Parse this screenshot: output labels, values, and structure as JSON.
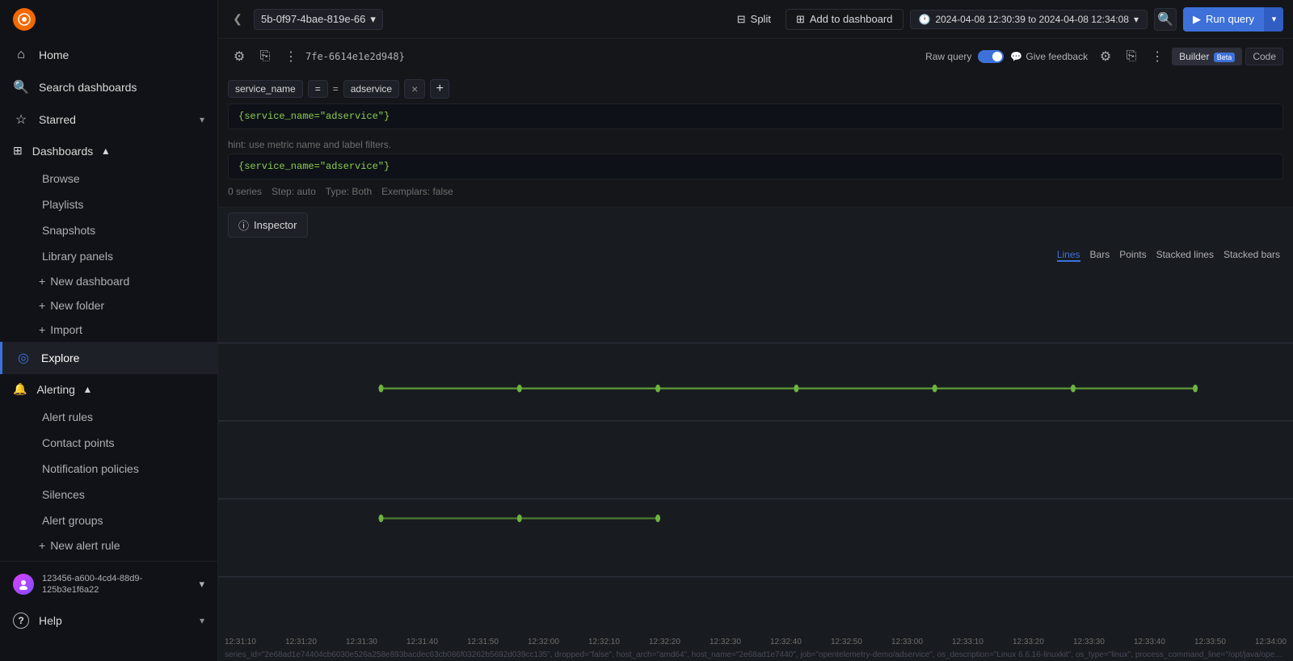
{
  "sidebar": {
    "logo": "G",
    "items": [
      {
        "id": "home",
        "label": "Home",
        "icon": "home-icon",
        "active": false
      },
      {
        "id": "search",
        "label": "Search dashboards",
        "icon": "search-icon",
        "active": false
      },
      {
        "id": "starred",
        "label": "Starred",
        "icon": "star-icon",
        "active": false,
        "expandable": true
      },
      {
        "id": "dashboards",
        "label": "Dashboards",
        "icon": "grid-icon",
        "active": false,
        "expandable": true,
        "expanded": true
      },
      {
        "id": "explore",
        "label": "Explore",
        "icon": "compass-icon",
        "active": true
      },
      {
        "id": "alerting",
        "label": "Alerting",
        "icon": "bell-icon",
        "active": false,
        "expandable": true,
        "expanded": true
      },
      {
        "id": "help",
        "label": "Help",
        "icon": "question-icon",
        "active": false,
        "expandable": true
      }
    ],
    "dashboards_sub": [
      {
        "id": "browse",
        "label": "Browse"
      },
      {
        "id": "playlists",
        "label": "Playlists"
      },
      {
        "id": "snapshots",
        "label": "Snapshots"
      },
      {
        "id": "library-panels",
        "label": "Library panels"
      }
    ],
    "dashboards_new": [
      {
        "id": "new-dashboard",
        "label": "New dashboard"
      },
      {
        "id": "new-folder",
        "label": "New folder"
      },
      {
        "id": "import",
        "label": "Import"
      }
    ],
    "alerting_sub": [
      {
        "id": "alert-rules",
        "label": "Alert rules"
      },
      {
        "id": "contact-points",
        "label": "Contact points"
      },
      {
        "id": "notification-policies",
        "label": "Notification policies"
      },
      {
        "id": "silences",
        "label": "Silences"
      },
      {
        "id": "alert-groups",
        "label": "Alert groups"
      }
    ],
    "alerting_new": [
      {
        "id": "new-alert-rule",
        "label": "New alert rule"
      }
    ],
    "user": {
      "id": "123456-a600-4cd4-88d9-125b3e1f6a22",
      "display": "123456-a600-4cd4-88d9-\n125b3e1f6a22",
      "initials": "U"
    }
  },
  "topbar": {
    "datasource": "5b-0f97-4bae-819e-66",
    "split_label": "Split",
    "add_dashboard_label": "Add to dashboard",
    "time_range": "2024-04-08 12:30:39 to 2024-04-08 12:34:08",
    "run_query_label": "Run query",
    "collapse_icon": "❮"
  },
  "query": {
    "id": "7fe-6614e1e2d948}",
    "raw_query_label": "Raw query",
    "feedback_label": "Give feedback",
    "builder_label": "Builder",
    "beta_label": "Beta",
    "code_label": "Code",
    "filter_key": "service_name",
    "filter_op": "=",
    "filter_value": "adservice",
    "code1": "{service_name=\"adservice\"}",
    "hint": "hint: use metric name and label filters.",
    "code2": "{service_name=\"adservice\"}",
    "meta_series": "0 series",
    "meta_step": "Step: auto",
    "meta_type": "Type: Both",
    "meta_exemplars": "Exemplars: false"
  },
  "inspector": {
    "label": "Inspector"
  },
  "chart": {
    "type_tabs": [
      "Lines",
      "Bars",
      "Points",
      "Stacked lines",
      "Stacked bars"
    ],
    "active_type": "Lines",
    "x_labels": [
      "12:31:10",
      "12:31:20",
      "12:31:30",
      "12:31:40",
      "12:31:50",
      "12:32:00",
      "12:32:10",
      "12:32:20",
      "12:32:30",
      "12:32:40",
      "12:32:50",
      "12:33:00",
      "12:33:10",
      "12:33:20",
      "12:33:30",
      "12:33:40",
      "12:33:50",
      "12:34:00"
    ],
    "bottom_text": "series_id=\"2e68ad1e74404cb6030e526a258e893bacdec63cb086f03262b5692d039cc135\", dropped=\"false\", host_arch=\"amd64\", host_name=\"2e68ad1e7440\", job=\"opentelemetry-demo/adservice\", os_description=\"Linux 6.6.16-linuxkit\", os_type=\"linux\", process_command_line=\"/opt/java/openjdk/bin/ja"
  }
}
